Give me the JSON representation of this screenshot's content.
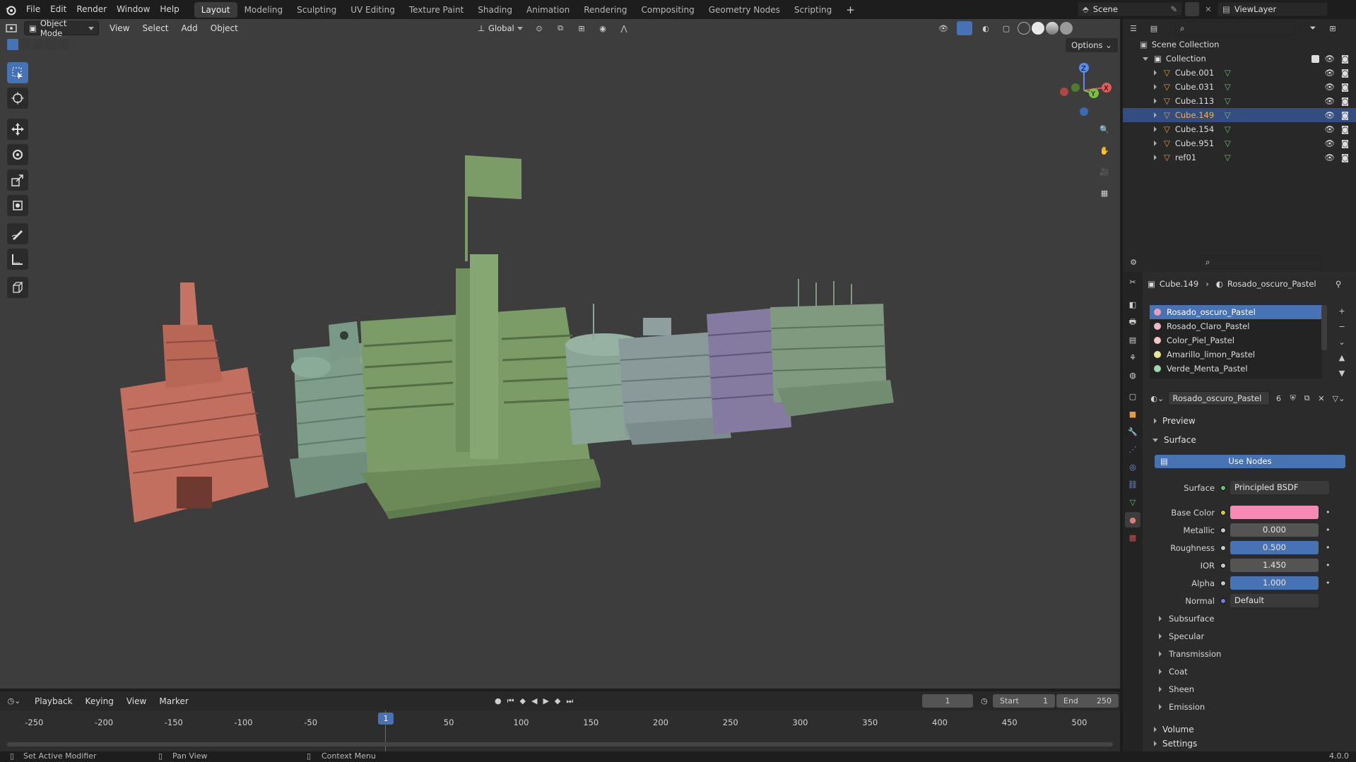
{
  "app": {
    "name": "Blender",
    "version": "4.0.0"
  },
  "menu": [
    "File",
    "Edit",
    "Render",
    "Window",
    "Help"
  ],
  "workspaces": [
    "Layout",
    "Modeling",
    "Sculpting",
    "UV Editing",
    "Texture Paint",
    "Shading",
    "Animation",
    "Rendering",
    "Compositing",
    "Geometry Nodes",
    "Scripting"
  ],
  "active_workspace": "Layout",
  "scene": {
    "name": "Scene",
    "view_layer": "ViewLayer"
  },
  "viewport": {
    "mode": "Object Mode",
    "menus": [
      "View",
      "Select",
      "Add",
      "Object"
    ],
    "orientation": "Global",
    "options_label": "Options",
    "gizmo_axes": [
      "X",
      "Y",
      "Z"
    ],
    "models": [
      {
        "name": "pink-building",
        "color": "#c26f5f"
      },
      {
        "name": "mint-building",
        "color": "#7e9e8a"
      },
      {
        "name": "tower-building",
        "color": "#7b9b67"
      },
      {
        "name": "round-building",
        "color": "#8aa596"
      },
      {
        "name": "gray-building",
        "color": "#8a9a9a"
      },
      {
        "name": "purple-building",
        "color": "#857a9f"
      },
      {
        "name": "green-building",
        "color": "#7f9a7e"
      }
    ]
  },
  "outliner": {
    "scene_collection": "Scene Collection",
    "collection": "Collection",
    "objects": [
      {
        "name": "Cube.001",
        "selected": false
      },
      {
        "name": "Cube.031",
        "selected": false
      },
      {
        "name": "Cube.113",
        "selected": false
      },
      {
        "name": "Cube.149",
        "selected": true
      },
      {
        "name": "Cube.154",
        "selected": false
      },
      {
        "name": "Cube.951",
        "selected": false
      },
      {
        "name": "ref01",
        "selected": false
      }
    ]
  },
  "properties": {
    "breadcrumb_object": "Cube.149",
    "breadcrumb_material": "Rosado_oscuro_Pastel",
    "material_slots": [
      {
        "name": "Rosado_oscuro_Pastel",
        "color": "#e8a0b8",
        "selected": true
      },
      {
        "name": "Rosado_Claro_Pastel",
        "color": "#f0b7c8",
        "selected": false
      },
      {
        "name": "Color_Piel_Pastel",
        "color": "#f3c6bf",
        "selected": false
      },
      {
        "name": "Amarillo_limon_Pastel",
        "color": "#e8e39a",
        "selected": false
      },
      {
        "name": "Verde_Menta_Pastel",
        "color": "#9fd6b0",
        "selected": false
      }
    ],
    "material_name": "Rosado_oscuro_Pastel",
    "user_count": "6",
    "sections": {
      "preview": "Preview",
      "surface": "Surface",
      "volume": "Volume",
      "settings": "Settings"
    },
    "use_nodes": "Use Nodes",
    "surface_label": "Surface",
    "surface_shader": "Principled BSDF",
    "fields": [
      {
        "label": "Base Color",
        "value": "",
        "type": "color",
        "color": "#f58bb5"
      },
      {
        "label": "Metallic",
        "value": "0.000",
        "type": "plain"
      },
      {
        "label": "Roughness",
        "value": "0.500",
        "type": "blue"
      },
      {
        "label": "IOR",
        "value": "1.450",
        "type": "plain"
      },
      {
        "label": "Alpha",
        "value": "1.000",
        "type": "blue"
      },
      {
        "label": "Normal",
        "value": "Default",
        "type": "dark"
      }
    ],
    "subpanels": [
      "Subsurface",
      "Specular",
      "Transmission",
      "Coat",
      "Sheen",
      "Emission"
    ]
  },
  "timeline": {
    "menus": [
      "Playback",
      "Keying",
      "View",
      "Marker"
    ],
    "current_frame": "1",
    "start_label": "Start",
    "start": "1",
    "end_label": "End",
    "end": "250",
    "ticks": [
      "-250",
      "-200",
      "-150",
      "-100",
      "-50",
      "50",
      "100",
      "150",
      "200",
      "250",
      "300",
      "350",
      "400",
      "450",
      "500"
    ],
    "playhead": "1"
  },
  "statusbar": {
    "items": [
      "Set Active Modifier",
      "Pan View",
      "Context Menu"
    ],
    "version": "4.0.0"
  }
}
